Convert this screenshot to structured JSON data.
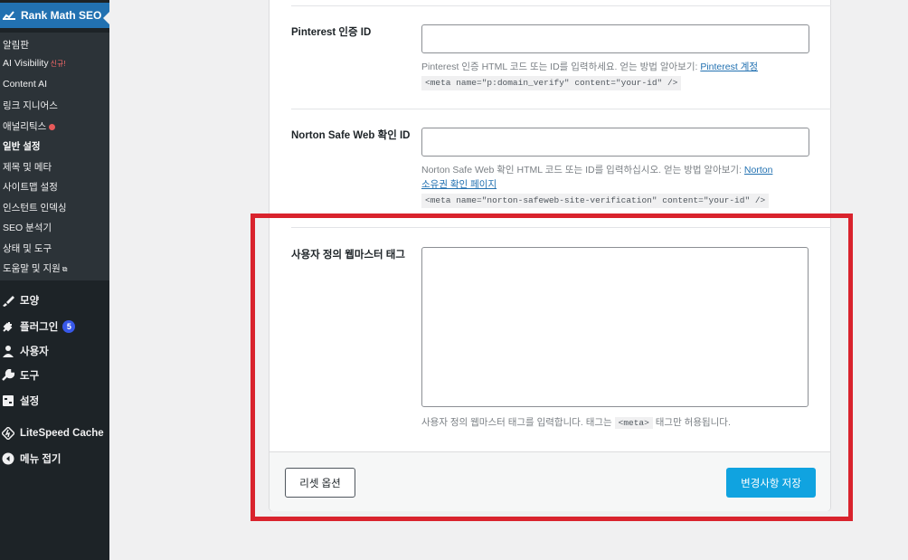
{
  "sidebar": {
    "plugin_title": "Rank Math SEO",
    "submenu": [
      {
        "label": "알림판"
      },
      {
        "label": "AI Visibility",
        "badge": "신규!"
      },
      {
        "label": "Content AI"
      },
      {
        "label": "링크 지니어스"
      },
      {
        "label": "애널리틱스",
        "dot": "red"
      },
      {
        "label": "일반 설정",
        "active": true
      },
      {
        "label": "제목 및 메타"
      },
      {
        "label": "사이트맵 설정"
      },
      {
        "label": "인스턴트 인덱싱"
      },
      {
        "label": "SEO 분석기"
      },
      {
        "label": "상태 및 도구"
      },
      {
        "label": "도움말 및 지원",
        "icon": "external-link-icon"
      }
    ],
    "menu": [
      {
        "label": "모양",
        "icon": "paintbrush-icon"
      },
      {
        "label": "플러그인",
        "icon": "plugin-icon",
        "count": "5"
      },
      {
        "label": "사용자",
        "icon": "user-icon"
      },
      {
        "label": "도구",
        "icon": "wrench-icon"
      },
      {
        "label": "설정",
        "icon": "settings-icon"
      },
      {
        "label": "LiteSpeed Cache",
        "icon": "litespeed-icon"
      },
      {
        "label": "메뉴 접기",
        "icon": "collapse-icon"
      }
    ]
  },
  "fields": {
    "pinterest": {
      "label": "Pinterest 인증 ID",
      "value": "",
      "help_text": "Pinterest 인증 HTML 코드 또는 ID를 입력하세요. 얻는 방법 알아보기: ",
      "help_link": "Pinterest 계정",
      "code": "<meta name=\"p:domain_verify\" content=\"your-id\" />"
    },
    "norton": {
      "label": "Norton Safe Web 확인 ID",
      "value": "",
      "help_text": "Norton Safe Web 확인 HTML 코드 또는 ID를 입력하십시오. 얻는 방법 알아보기: ",
      "help_link_1": "Norton",
      "help_link_2": "소유권 확인 페이지",
      "code": "<meta name=\"norton-safeweb-site-verification\" content=\"your-id\" />"
    },
    "custom": {
      "label": "사용자 정의 웹마스터 태그",
      "value": "",
      "help_before": "사용자 정의 웹마스터 태그를 입력합니다. 태그는 ",
      "help_code": "<meta>",
      "help_after": " 태그만 허용됩니다."
    }
  },
  "footer": {
    "reset_label": "리셋 옵션",
    "save_label": "변경사항 저장"
  },
  "colors": {
    "sidebar_bg": "#1d2327",
    "active_bg": "#2271b1",
    "save_button": "#10a3e0",
    "highlight": "#d9232d"
  }
}
